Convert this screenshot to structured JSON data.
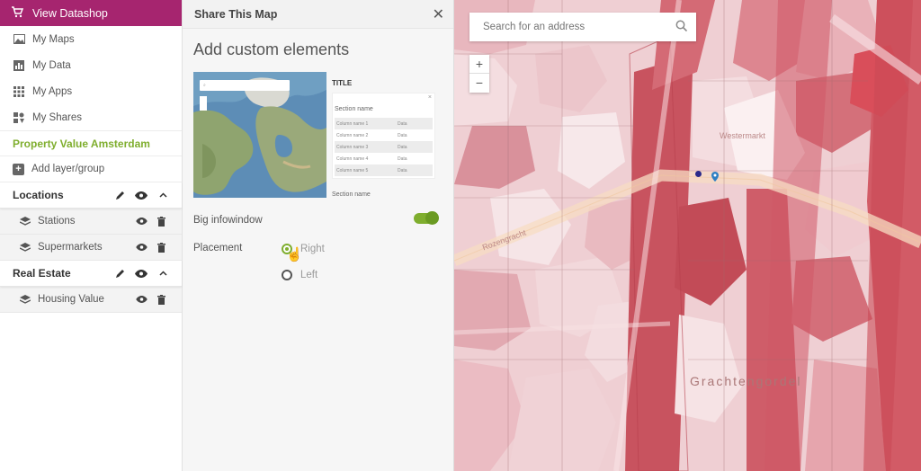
{
  "sidebar": {
    "top_label": "View Datashop",
    "nav": [
      {
        "label": "My Maps",
        "icon": "image-icon"
      },
      {
        "label": "My Data",
        "icon": "bar-chart-icon"
      },
      {
        "label": "My Apps",
        "icon": "grid-icon"
      },
      {
        "label": "My Shares",
        "icon": "share-pieces-icon"
      }
    ],
    "project_title": "Property Value Amsterdam",
    "add_label": "Add layer/group",
    "groups": [
      {
        "name": "Locations",
        "layers": [
          "Stations",
          "Supermarkets"
        ]
      },
      {
        "name": "Real Estate",
        "layers": [
          "Housing Value"
        ]
      }
    ]
  },
  "panel": {
    "title": "Share This Map",
    "close": "✕",
    "section_title": "Add custom elements",
    "preview": {
      "title": "TITLE",
      "close": "×",
      "section_name": "Section name",
      "rows": [
        {
          "name": "Column name 1",
          "value": "Data"
        },
        {
          "name": "Column name 2",
          "value": "Data"
        },
        {
          "name": "Column name 3",
          "value": "Data"
        },
        {
          "name": "Column name 4",
          "value": "Data"
        },
        {
          "name": "Column name 5",
          "value": "Data"
        }
      ],
      "section_name_2": "Section name"
    },
    "big_infowindow_label": "Big infowindow",
    "big_infowindow_on": true,
    "placement_label": "Placement",
    "placement_options": [
      "Right",
      "Left"
    ],
    "placement_selected": "Right"
  },
  "map": {
    "search_placeholder": "Search for an address",
    "zoom_in": "+",
    "zoom_out": "−",
    "labels": [
      "Westermarkt",
      "Rozengracht",
      "Grachtengordel"
    ]
  },
  "colors": {
    "brand": "#a6256f",
    "accent": "#7fae2e"
  }
}
